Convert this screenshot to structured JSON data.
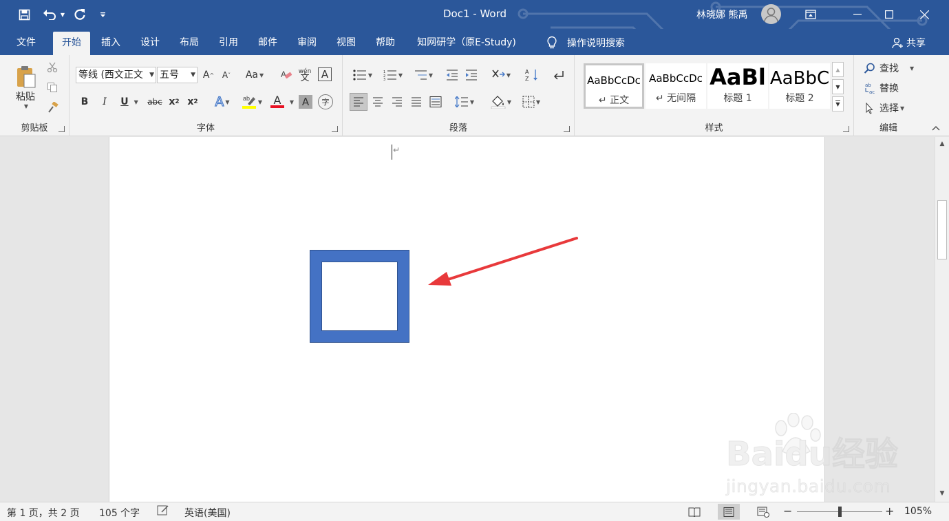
{
  "titlebar": {
    "doc_title": "Doc1 - Word",
    "user_name": "林晓娜 熊禹",
    "icons": [
      "save-icon",
      "undo-icon",
      "redo-icon",
      "customize-qat-icon",
      "ribbon-display-icon",
      "minimize-icon",
      "maximize-icon",
      "close-icon"
    ]
  },
  "tabs": [
    {
      "label": "文件"
    },
    {
      "label": "开始"
    },
    {
      "label": "插入"
    },
    {
      "label": "设计"
    },
    {
      "label": "布局"
    },
    {
      "label": "引用"
    },
    {
      "label": "邮件"
    },
    {
      "label": "审阅"
    },
    {
      "label": "视图"
    },
    {
      "label": "帮助"
    },
    {
      "label": "知网研学（原E-Study)"
    }
  ],
  "active_tab": "开始",
  "tell_me": "操作说明搜索",
  "share": "共享",
  "ribbon": {
    "clipboard": {
      "label": "剪贴板",
      "paste": "粘贴"
    },
    "font": {
      "label": "字体",
      "font_name": "等线 (西文正文",
      "font_size": "五号",
      "grow": "A",
      "shrink": "A",
      "change_case": "Aa",
      "phonetic": "wén",
      "bold": "B",
      "italic": "I",
      "underline": "U",
      "strike": "abc",
      "subscript_base": "x",
      "subscript": "2",
      "superscript_base": "x",
      "superscript": "2",
      "text_effects": "A",
      "font_color": "A",
      "char_shading": "A",
      "enclose": "字",
      "border_char": "A"
    },
    "paragraph": {
      "label": "段落"
    },
    "styles": {
      "label": "样式",
      "items": [
        {
          "sample": "AaBbCcDc",
          "name": "↵ 正文"
        },
        {
          "sample": "AaBbCcDc",
          "name": "↵ 无间隔"
        },
        {
          "sample": "AaBl",
          "name": "标题 1"
        },
        {
          "sample": "AaBbC",
          "name": "标题 2"
        }
      ]
    },
    "editing": {
      "label": "编辑",
      "find": "查找",
      "replace": "替换",
      "select": "选择"
    }
  },
  "document": {
    "paragraph_mark": "↵"
  },
  "watermark": {
    "logo": "Baidu经验",
    "url": "jingyan.baidu.com"
  },
  "statusbar": {
    "page": "第 1 页，共 2 页",
    "words": "105 个字",
    "language": "英语(美国)",
    "zoom_minus": "−",
    "zoom_plus": "+",
    "zoom": "105%"
  },
  "colors": {
    "accent": "#2b579a",
    "shape_fill": "#4472c4",
    "arrow": "#e8393b",
    "highlight": "#ffff00",
    "font_color": "#e81123"
  }
}
